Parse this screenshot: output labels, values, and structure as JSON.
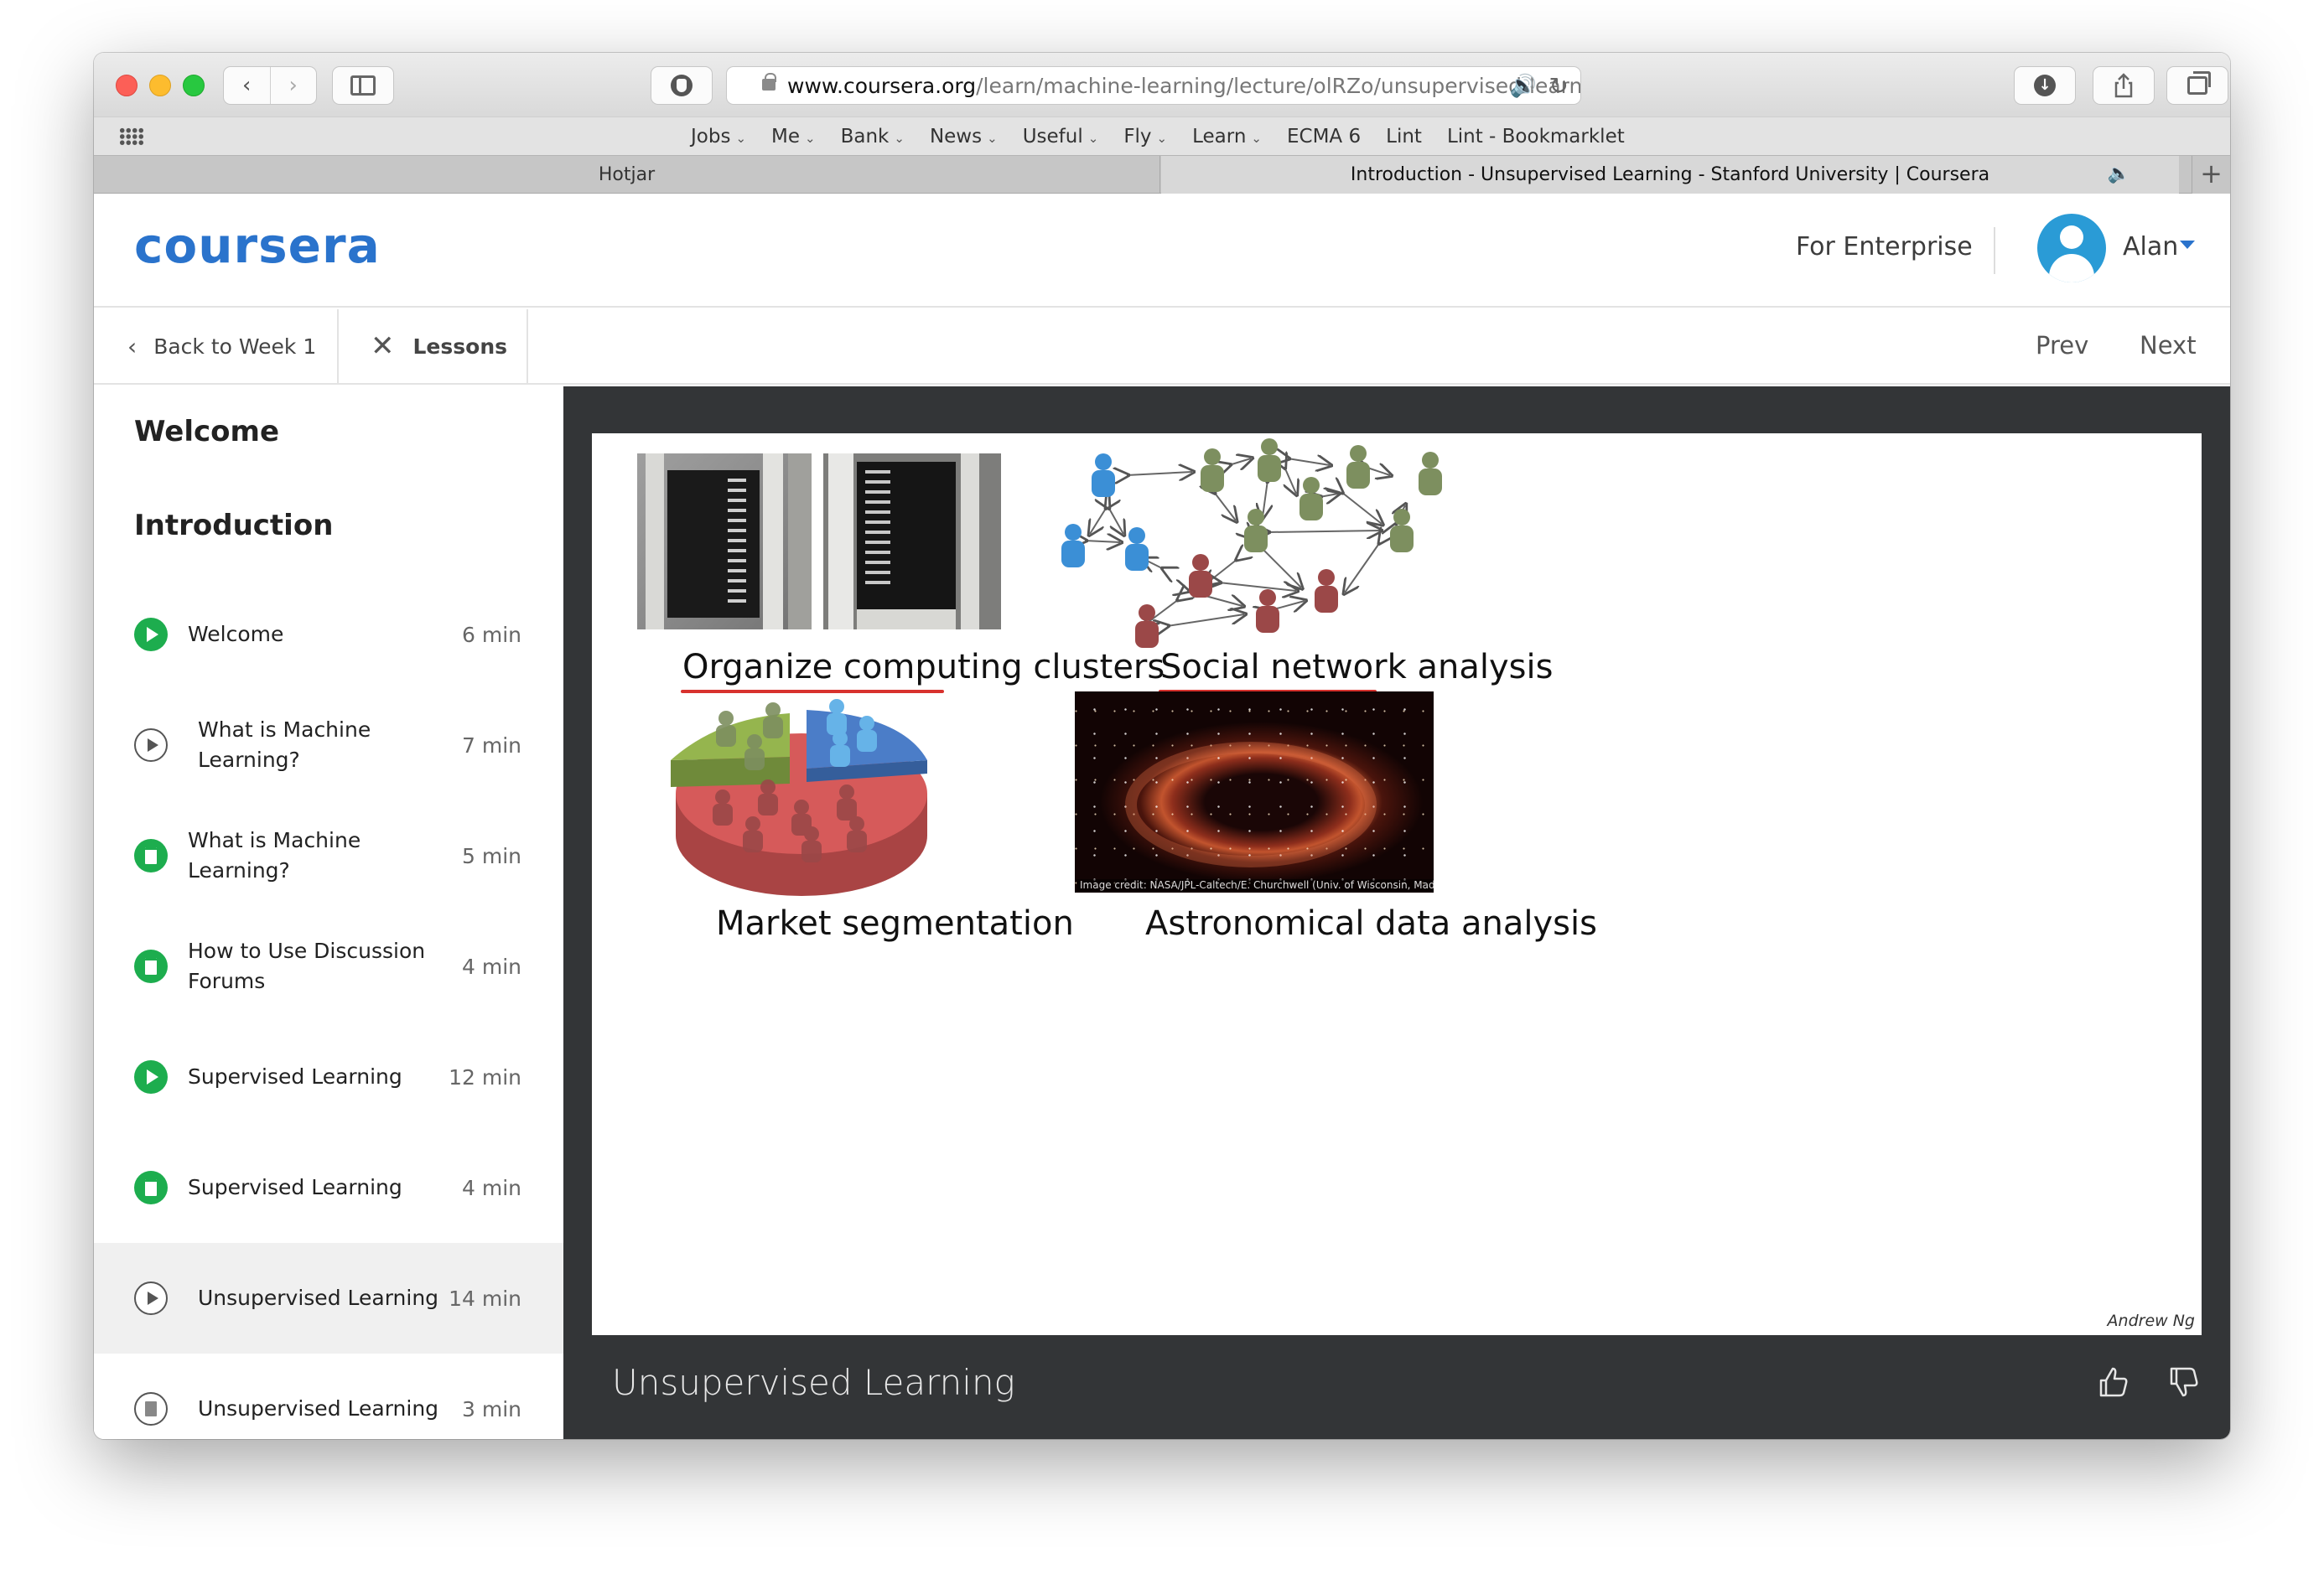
{
  "browser": {
    "url_host": "www.coursera.org",
    "url_path": "/learn/machine-learning/lecture/olRZo/unsupervised-learni",
    "favorites": [
      {
        "label": "Jobs",
        "dropdown": true
      },
      {
        "label": "Me",
        "dropdown": true
      },
      {
        "label": "Bank",
        "dropdown": true
      },
      {
        "label": "News",
        "dropdown": true
      },
      {
        "label": "Useful",
        "dropdown": true
      },
      {
        "label": "Fly",
        "dropdown": true
      },
      {
        "label": "Learn",
        "dropdown": true
      },
      {
        "label": "ECMA 6",
        "dropdown": false
      },
      {
        "label": "Lint",
        "dropdown": false
      },
      {
        "label": "Lint - Bookmarklet",
        "dropdown": false
      }
    ],
    "tabs": [
      {
        "title": "Hotjar",
        "active": false
      },
      {
        "title": "Introduction - Unsupervised Learning - Stanford University | Coursera",
        "active": true
      }
    ]
  },
  "header": {
    "logo": "coursera",
    "enterprise_label": "For Enterprise",
    "user_name": "Alan",
    "brand_color": "#2a73cc"
  },
  "subnav": {
    "back_label": "Back to Week 1",
    "lessons_label": "Lessons",
    "prev_label": "Prev",
    "next_label": "Next"
  },
  "sidebar": {
    "sections": [
      "Welcome",
      "Introduction"
    ],
    "lessons": [
      {
        "label": "Welcome",
        "duration": "6 min",
        "type": "video",
        "completed": true
      },
      {
        "label": "What is Machine Learning?",
        "duration": "7 min",
        "type": "video",
        "completed": false
      },
      {
        "label": "What is Machine Learning?",
        "duration": "5 min",
        "type": "reading",
        "completed": true
      },
      {
        "label": "How to Use Discussion Forums",
        "duration": "4 min",
        "type": "reading",
        "completed": true
      },
      {
        "label": "Supervised Learning",
        "duration": "12 min",
        "type": "video",
        "completed": true
      },
      {
        "label": "Supervised Learning",
        "duration": "4 min",
        "type": "reading",
        "completed": true
      },
      {
        "label": "Unsupervised Learning",
        "duration": "14 min",
        "type": "video",
        "completed": false,
        "active": true
      },
      {
        "label": "Unsupervised Learning",
        "duration": "3 min",
        "type": "reading",
        "completed": false
      }
    ],
    "completed_color": "#1dad4e"
  },
  "video": {
    "title": "Unsupervised Learning",
    "slide": {
      "captions": {
        "clusters": "Organize computing clusters",
        "social": "Social network analysis",
        "market": "Market segmentation",
        "astro": "Astronomical data analysis"
      },
      "image_credit": "Image credit: NASA/JPL-Caltech/E. Churchwell (Univ. of Wisconsin, Madison)",
      "author": "Andrew Ng"
    }
  }
}
